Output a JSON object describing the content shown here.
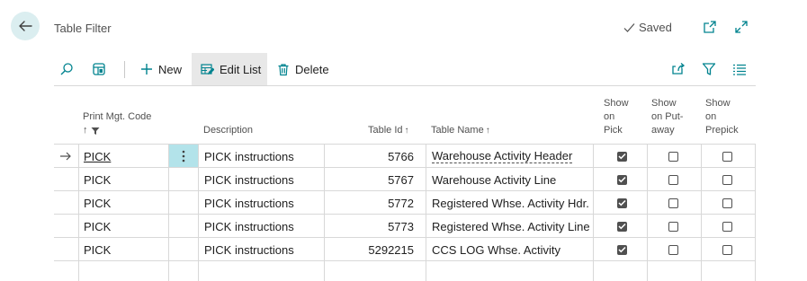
{
  "header": {
    "title": "Table Filter",
    "status": "Saved"
  },
  "toolbar": {
    "new_label": "New",
    "edit_list_label": "Edit List",
    "delete_label": "Delete"
  },
  "columns": {
    "code": "Print Mgt. Code",
    "description": "Description",
    "table_id": "Table Id",
    "table_name": "Table Name",
    "show_pick": [
      "Show",
      "on",
      "Pick"
    ],
    "show_putaway": [
      "Show",
      "on Put-",
      "away"
    ],
    "show_prepick": [
      "Show",
      "on",
      "Prepick"
    ]
  },
  "rows": [
    {
      "code": "PICK",
      "description": "PICK instructions",
      "table_id": "5766",
      "table_name": "Warehouse Activity Header",
      "pick": true,
      "putaway": false,
      "prepick": false
    },
    {
      "code": "PICK",
      "description": "PICK instructions",
      "table_id": "5767",
      "table_name": "Warehouse Activity Line",
      "pick": true,
      "putaway": false,
      "prepick": false
    },
    {
      "code": "PICK",
      "description": "PICK instructions",
      "table_id": "5772",
      "table_name": "Registered Whse. Activity Hdr.",
      "pick": true,
      "putaway": false,
      "prepick": false
    },
    {
      "code": "PICK",
      "description": "PICK instructions",
      "table_id": "5773",
      "table_name": "Registered Whse. Activity Line",
      "pick": true,
      "putaway": false,
      "prepick": false
    },
    {
      "code": "PICK",
      "description": "PICK instructions",
      "table_id": "5292215",
      "table_name": "CCS LOG Whse. Activity",
      "pick": true,
      "putaway": false,
      "prepick": false
    }
  ],
  "colors": {
    "accent": "#00838f",
    "selected_cell": "#b3e3ea",
    "back_button_bg": "#dbeef0"
  },
  "icons": [
    "back-arrow-icon",
    "checkmark-icon",
    "open-new-window-icon",
    "expand-icon",
    "search-icon",
    "view-layout-icon",
    "plus-icon",
    "edit-list-icon",
    "trash-icon",
    "share-icon",
    "filter-icon",
    "list-icon",
    "row-arrow-icon",
    "kebab-icon",
    "sort-up-icon",
    "filter-small-icon"
  ]
}
